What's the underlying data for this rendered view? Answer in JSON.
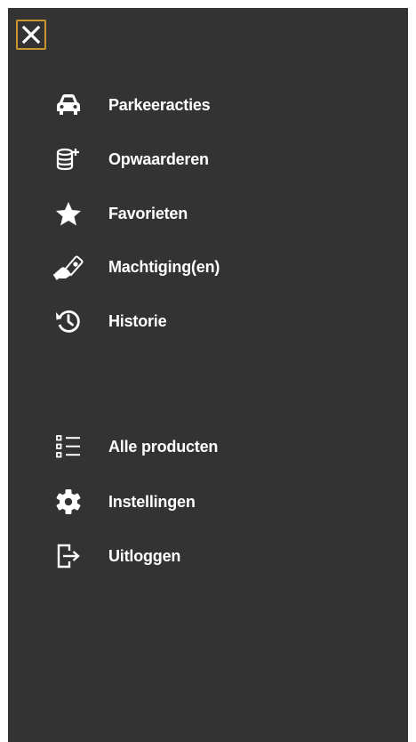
{
  "drawer": {
    "close_icon": "close-icon",
    "accent_color": "#c8962d",
    "background_color": "#333333"
  },
  "menu": {
    "primary": [
      {
        "label": "Parkeeracties",
        "icon": "car-icon"
      },
      {
        "label": "Opwaarderen",
        "icon": "coins-plus-icon"
      },
      {
        "label": "Favorieten",
        "icon": "star-icon"
      },
      {
        "label": "Machtiging(en)",
        "icon": "hand-card-icon"
      },
      {
        "label": "Historie",
        "icon": "history-icon"
      }
    ],
    "secondary": [
      {
        "label": "Alle producten",
        "icon": "list-icon"
      },
      {
        "label": "Instellingen",
        "icon": "gear-icon"
      },
      {
        "label": "Uitloggen",
        "icon": "logout-icon"
      }
    ]
  }
}
